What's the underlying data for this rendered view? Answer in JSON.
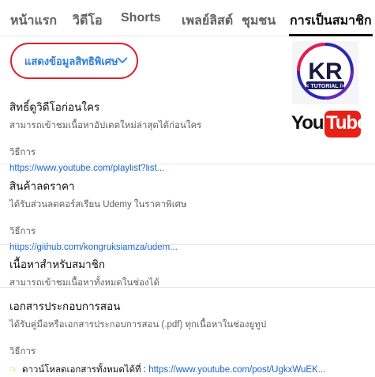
{
  "tabs": [
    {
      "label": "หน้าแรก"
    },
    {
      "label": "วิดีโอ"
    },
    {
      "label": "Shorts"
    },
    {
      "label": "เพลย์ลิสต์"
    },
    {
      "label": "ชุมชน"
    },
    {
      "label": "การเป็นสมาชิก"
    }
  ],
  "active_tab": 5,
  "show_button": {
    "label": "แสดงข้อมูลสิทธิพิเศษ"
  },
  "brand": {
    "kr_logo_text": "KR",
    "kr_logo_subtext": "< TUTORIAL />",
    "youtube_you": "You",
    "youtube_tube": "Tube"
  },
  "perks": [
    {
      "title": "สิทธิ์ดูวิดีโอก่อนใคร",
      "desc": "สามารถเข้าชมเนื้อหาอัปเดตใหม่ล่าสุดได้ก่อนใคร",
      "how_label": "วิธีการ",
      "link": "https://www.youtube.com/playlist?list..."
    },
    {
      "title": "สินค้าลดราคา",
      "desc": "ได้รับส่วนลดคอร์สเรียน Udemy ในราคาพิเศษ",
      "how_label": "วิธีการ",
      "link": "https://github.com/kongruksiamza/udem..."
    },
    {
      "title": "เนื้อหาสำหรับสมาชิก",
      "desc": "สามารถเข้าชมเนื้อหาทั้งหมดในช่องได้"
    },
    {
      "title": "เอกสารประกอบการสอน",
      "desc": "ได้รับคู่มือหรือเอกสารประกอบการสอน (.pdf) ทุกเนื้อหาในช่องยูทูป",
      "how_label": "วิธีการ",
      "line_text": "ดาวน์โหลดเอกสารทั้งหมดได้ที่ : ",
      "link": "https://www.youtube.com/post/UgkxWuEK..."
    }
  ],
  "colors": {
    "accent_red": "#e0202a",
    "link_blue": "#1b63c9",
    "youtube_red": "#e62117"
  }
}
